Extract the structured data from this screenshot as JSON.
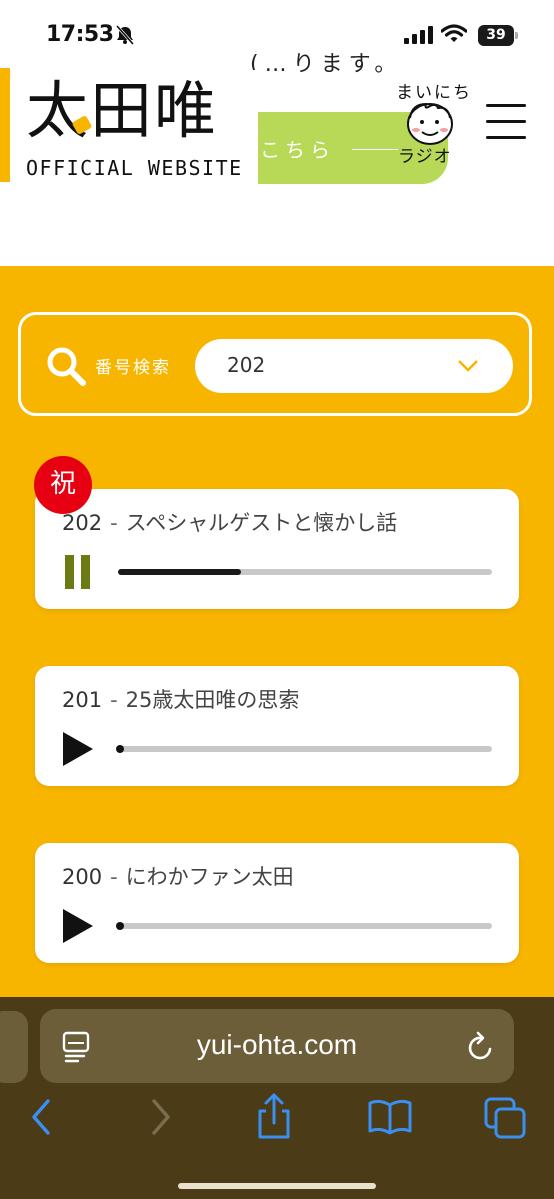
{
  "status_bar": {
    "time": "17:53",
    "battery": "39"
  },
  "header": {
    "peek_text": "(…ります。",
    "logo_main": "太田唯",
    "logo_sub": "OFFICIAL WEBSITE",
    "banner_text": "こちら",
    "radio_top": "まいにち",
    "radio_bottom": "ラジオ"
  },
  "search": {
    "label": "番号検索",
    "selected": "202"
  },
  "episodes": [
    {
      "number": "202",
      "separator": "-",
      "title": "スペシャルゲストと懐かし話",
      "state": "playing",
      "progress": 0.33,
      "badge": "祝"
    },
    {
      "number": "201",
      "separator": "-",
      "title": "25歳太田唯の思索",
      "state": "paused",
      "progress": 0
    },
    {
      "number": "200",
      "separator": "-",
      "title": "にわかファン太田",
      "state": "paused",
      "progress": 0
    }
  ],
  "browser": {
    "url": "yui-ohta.com"
  },
  "colors": {
    "accent": "#f8b500",
    "badge": "#e60012",
    "banner": "#b8d858",
    "control": "#6b7a12"
  }
}
